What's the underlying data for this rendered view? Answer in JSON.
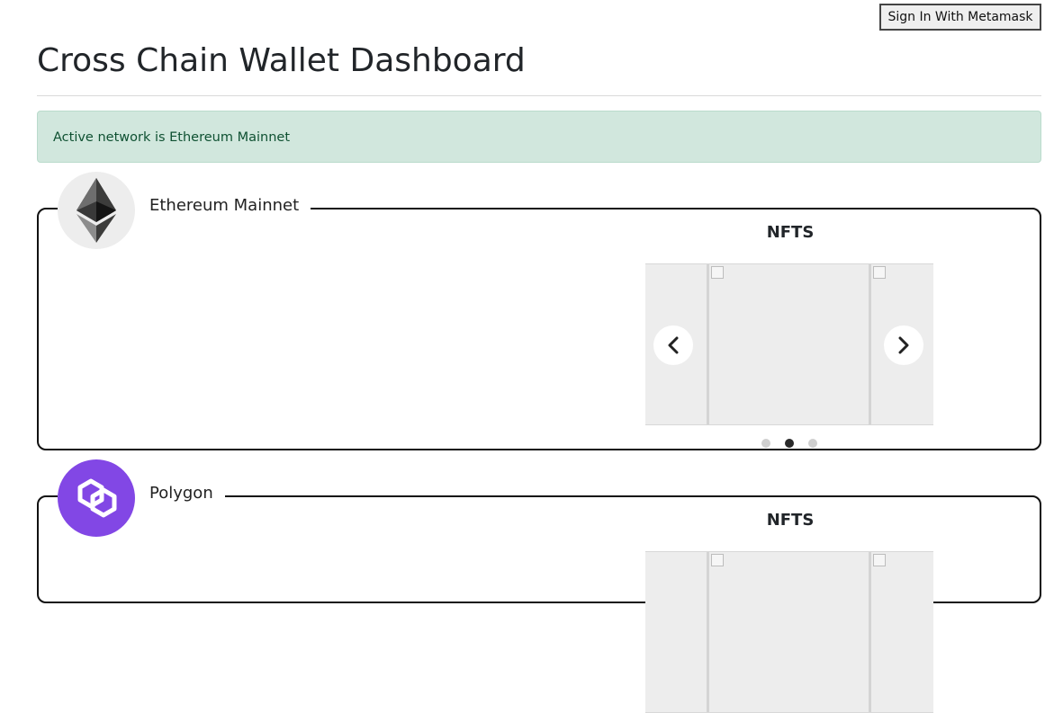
{
  "header": {
    "signin_label": "Sign In With Metamask",
    "title": "Cross Chain Wallet Dashboard"
  },
  "alert": {
    "message": "Active network is Ethereum Mainnet",
    "color": "#d1e7dd"
  },
  "networks": [
    {
      "name": "Ethereum Mainnet",
      "logo": "ethereum-logo",
      "nfts_heading": "NFTS",
      "carousel": {
        "slide_count": 3,
        "active_slide": 2
      }
    },
    {
      "name": "Polygon",
      "logo": "polygon-logo",
      "logo_color": "#8247e5",
      "nfts_heading": "NFTS"
    }
  ],
  "icons": {
    "prev": "chevron-left-icon",
    "next": "chevron-right-icon",
    "broken_image": "broken-image-icon"
  }
}
